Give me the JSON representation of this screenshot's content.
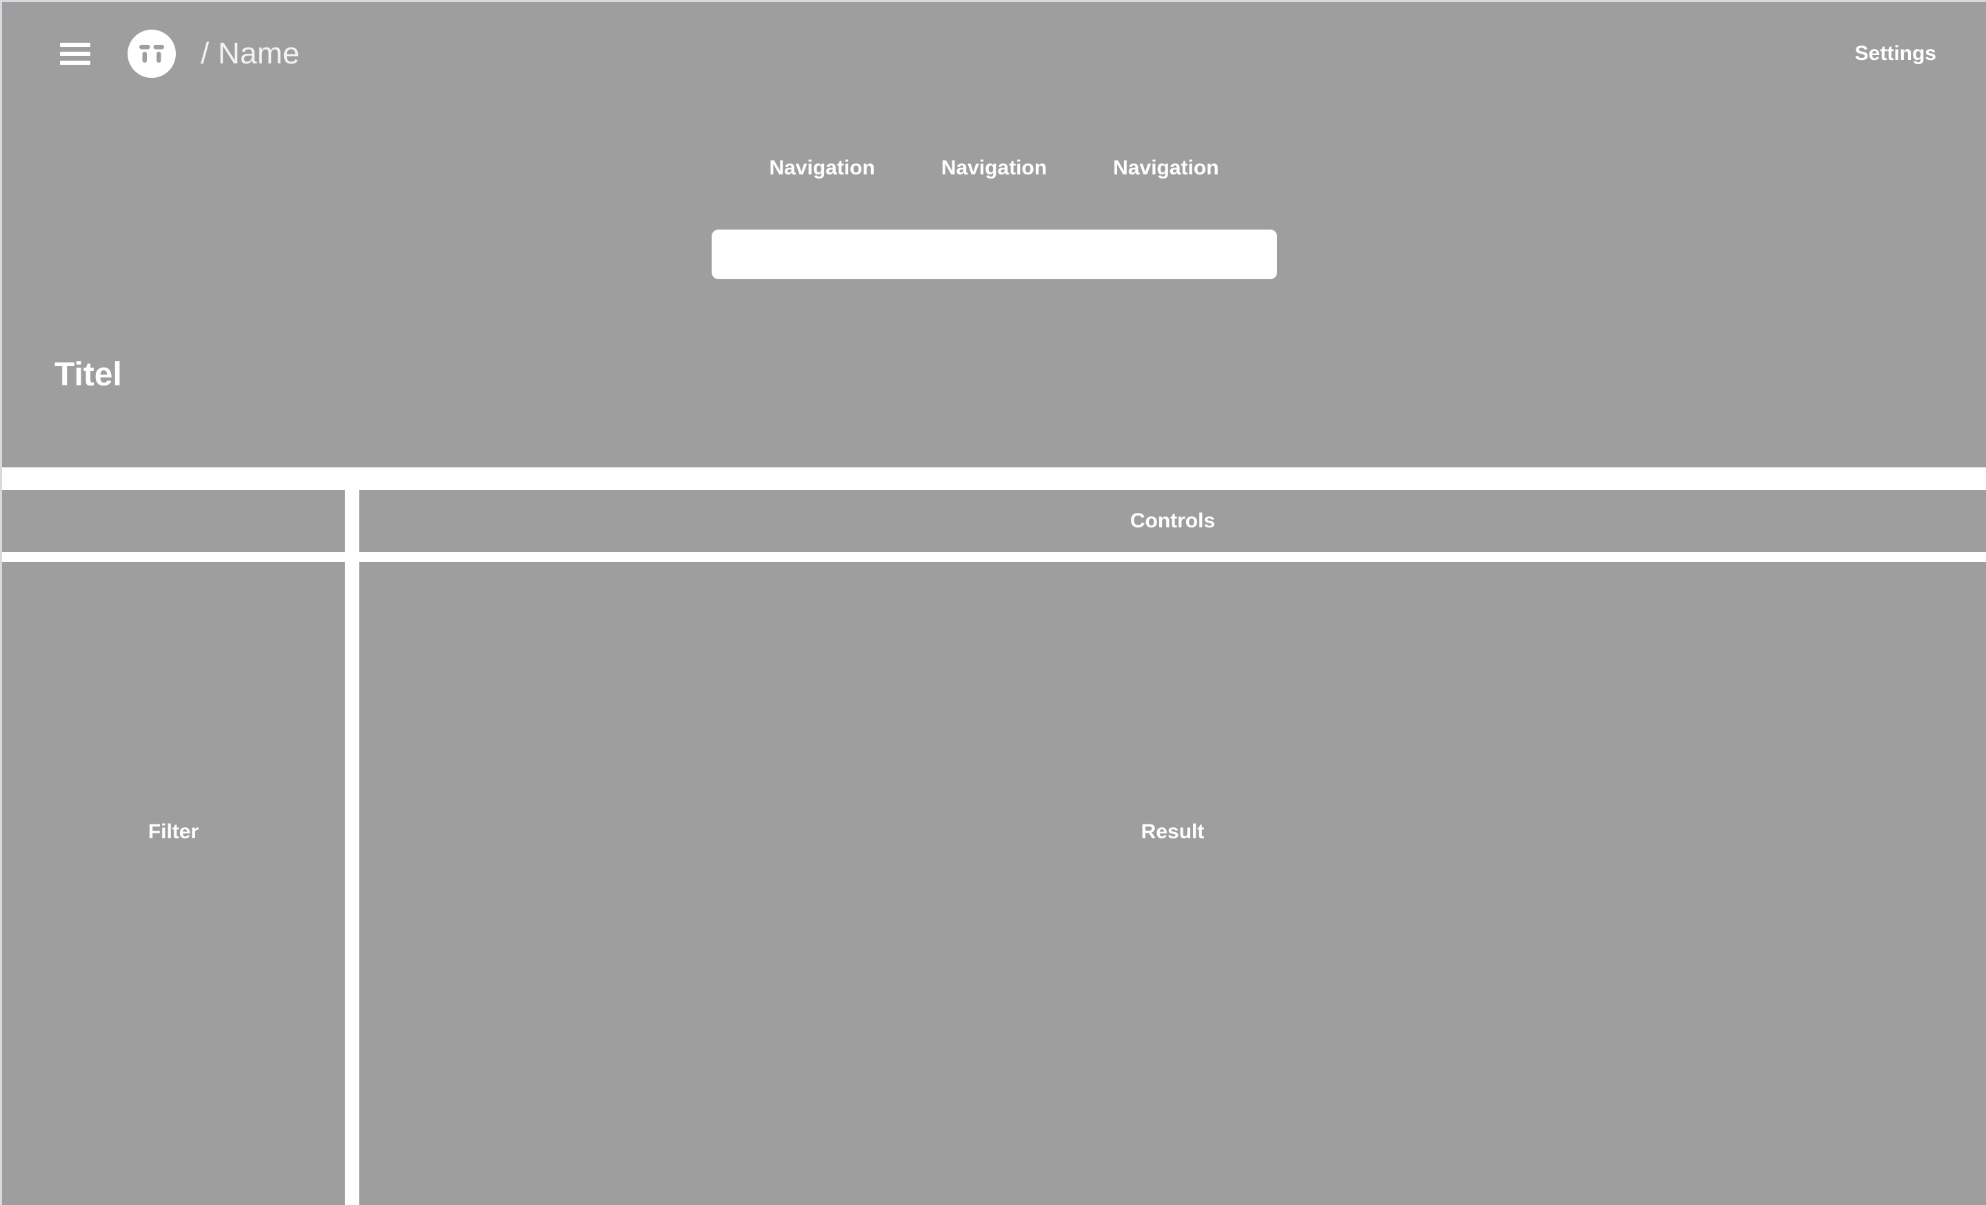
{
  "theme": {
    "panel_gray": "#9e9e9e",
    "gap_white": "#ffffff",
    "text_white": "#ffffff",
    "brand_text": "#f2f2f2",
    "page_border": "#d7d9e0"
  },
  "header": {
    "menu_icon": "hamburger-menu-icon",
    "logo_icon": "circle-logo-icon",
    "brand_name": "/ Name",
    "settings_label": "Settings"
  },
  "navigation": {
    "items": [
      {
        "label": "Navigation"
      },
      {
        "label": "Navigation"
      },
      {
        "label": "Navigation"
      }
    ]
  },
  "search": {
    "value": "",
    "placeholder": ""
  },
  "title": {
    "text": "Titel"
  },
  "controls": {
    "label": "Controls"
  },
  "panels": {
    "filter_label": "Filter",
    "result_label": "Result"
  }
}
